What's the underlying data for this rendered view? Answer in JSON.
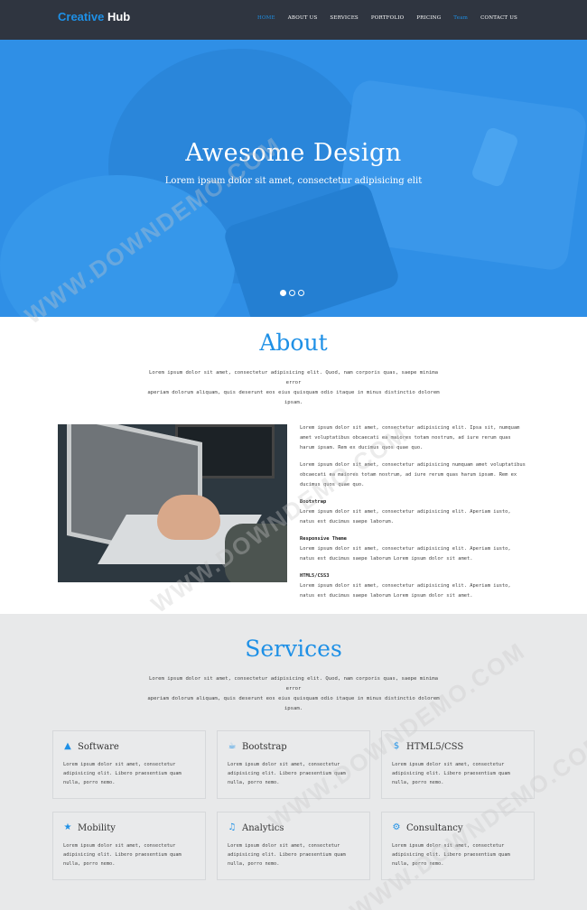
{
  "nav": {
    "brand_part1": "Creative",
    "brand_part2": "Hub",
    "items": [
      {
        "label": "HOME",
        "active": true
      },
      {
        "label": "ABOUT US",
        "active": false
      },
      {
        "label": "SERVICES",
        "active": false
      },
      {
        "label": "PORTFOLIO",
        "active": false
      },
      {
        "label": "PRICING",
        "active": false
      },
      {
        "label": "Team",
        "active": true
      },
      {
        "label": "CONTACT US",
        "active": false
      }
    ]
  },
  "hero": {
    "title": "Awesome Design",
    "subtitle": "Lorem ipsum dolor sit amet, consectetur adipisicing elit",
    "slides": 3,
    "active_slide": 1
  },
  "about": {
    "title": "About",
    "intro_line1": "Lorem ipsum dolor sit amet, consectetur adipisicing elit. Quod, nam corporis quas, saepe minima error",
    "intro_line2": "aperiam dolorum aliquam, quis deserunt eos eius quisquam odio itaque in minus distinctio dolorem ipsam.",
    "para1": "Lorem ipsum dolor sit amet, consectetur adipisicing elit. Ipsa sit, numquam amet voluptatibus obcaecati ea maiores totam nostrum, ad iure rerum quas harum ipsam. Rem ex ducimus quos quae quo.",
    "para2": "Lorem ipsum dolor sit amet, consectetur adipisicing numquam amet voluptatibus obcaecati ea maiores totam nostrum, ad iure rerum quas harum ipsam. Rem ex ducimus quos quae quo.",
    "features": [
      {
        "heading": "Bootstrap",
        "text": "Lorem ipsum dolor sit amet, consectetur adipisicing elit. Aperiam iusto, natus est ducimus saepe laborum."
      },
      {
        "heading": "Responsive Theme",
        "text": "Lorem ipsum dolor sit amet, consectetur adipisicing elit. Aperiam iusto, natus est ducimus saepe laborum Lorem ipsum dolor sit amet."
      },
      {
        "heading": "HTML5/CSS3",
        "text": "Lorem ipsum dolor sit amet, consectetur adipisicing elit. Aperiam iusto, natus est ducimus saepe laborum Lorem ipsum dolor sit amet."
      }
    ]
  },
  "services": {
    "title": "Services",
    "intro_line1": "Lorem ipsum dolor sit amet, consectetur adipisicing elit. Quod, nam corporis quas, saepe minima error",
    "intro_line2": "aperiam dolorum aliquam, quis deserunt eos eius quisquam odio itaque in minus distinctio dolorem ipsam.",
    "card_text": "Lorem ipsum dolor sit amet, consectetur adipisicing elit. Libero praesentium quam nulla, porro nemo.",
    "cards": [
      {
        "title": "Software",
        "icon": "cone-icon",
        "glyph": "▲"
      },
      {
        "title": "Bootstrap",
        "icon": "coffee-cup-icon",
        "glyph": "☕"
      },
      {
        "title": "HTML5/CSS",
        "icon": "dollar-circle-icon",
        "glyph": "$"
      },
      {
        "title": "Mobility",
        "icon": "star-icon",
        "glyph": "★"
      },
      {
        "title": "Analytics",
        "icon": "music-note-icon",
        "glyph": "♫"
      },
      {
        "title": "Consultancy",
        "icon": "gear-icon",
        "glyph": "⚙"
      }
    ]
  },
  "watermark": "WWW.DOWNDEMO.COM",
  "colors": {
    "accent": "#1e90e6",
    "nav_bg": "#2f3540",
    "hero_bg": "#2f8fe6",
    "services_bg": "#e8e9ea"
  }
}
